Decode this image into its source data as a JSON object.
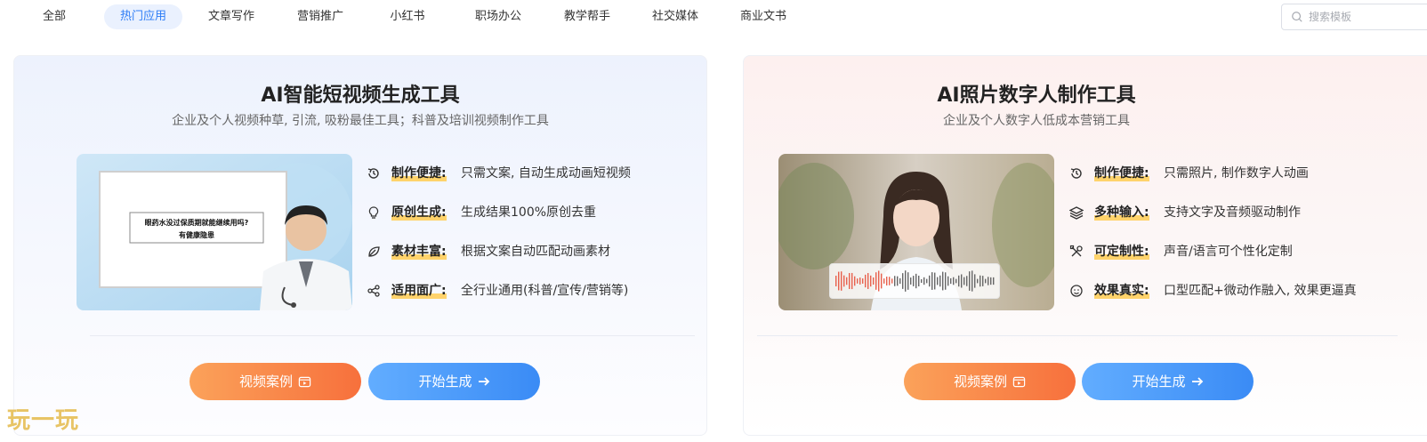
{
  "nav": {
    "tabs": [
      {
        "label": "全部",
        "active": false
      },
      {
        "label": "热门应用",
        "active": true
      },
      {
        "label": "文章写作",
        "active": false
      },
      {
        "label": "营销推广",
        "active": false
      },
      {
        "label": "小红书",
        "active": false
      },
      {
        "label": "职场办公",
        "active": false
      },
      {
        "label": "教学帮手",
        "active": false
      },
      {
        "label": "社交媒体",
        "active": false
      },
      {
        "label": "商业文书",
        "active": false
      }
    ],
    "search_placeholder": "搜索模板"
  },
  "cards": [
    {
      "title": "AI智能短视频生成工具",
      "subtitle": "企业及个人视频种草, 引流, 吸粉最佳工具；科普及培训视频制作工具",
      "thumb_caption_line1": "眼药水没过保质期就能继续用吗?",
      "thumb_caption_line2": "有健康隐患",
      "features": [
        {
          "icon": "clock-refresh-icon",
          "key": "制作便捷:",
          "text": "只需文案, 自动生成动画短视频"
        },
        {
          "icon": "lightbulb-icon",
          "key": "原创生成:",
          "text": "生成结果100%原创去重"
        },
        {
          "icon": "leaf-icon",
          "key": "素材丰富:",
          "text": "根据文案自动匹配动画素材"
        },
        {
          "icon": "share-icon",
          "key": "适用面广:",
          "text": "全行业通用(科普/宣传/营销等)"
        }
      ],
      "btn_example": "视频案例",
      "btn_start": "开始生成"
    },
    {
      "title": "AI照片数字人制作工具",
      "subtitle": "企业及个人数字人低成本营销工具",
      "features": [
        {
          "icon": "clock-refresh-icon",
          "key": "制作便捷:",
          "text": "只需照片, 制作数字人动画"
        },
        {
          "icon": "layers-icon",
          "key": "多种输入:",
          "text": "支持文字及音频驱动制作"
        },
        {
          "icon": "tools-icon",
          "key": "可定制性:",
          "text": "声音/语言可个性化定制"
        },
        {
          "icon": "smile-icon",
          "key": "效果真实:",
          "text": "口型匹配+微动作融入, 效果更逼真"
        }
      ],
      "btn_example": "视频案例",
      "btn_start": "开始生成"
    }
  ],
  "watermark": "玩一玩",
  "colors": {
    "accent": "#2d7df6",
    "orange": "#f7703c",
    "blue": "#3a8bf5",
    "highlight": "#ffd36b"
  }
}
